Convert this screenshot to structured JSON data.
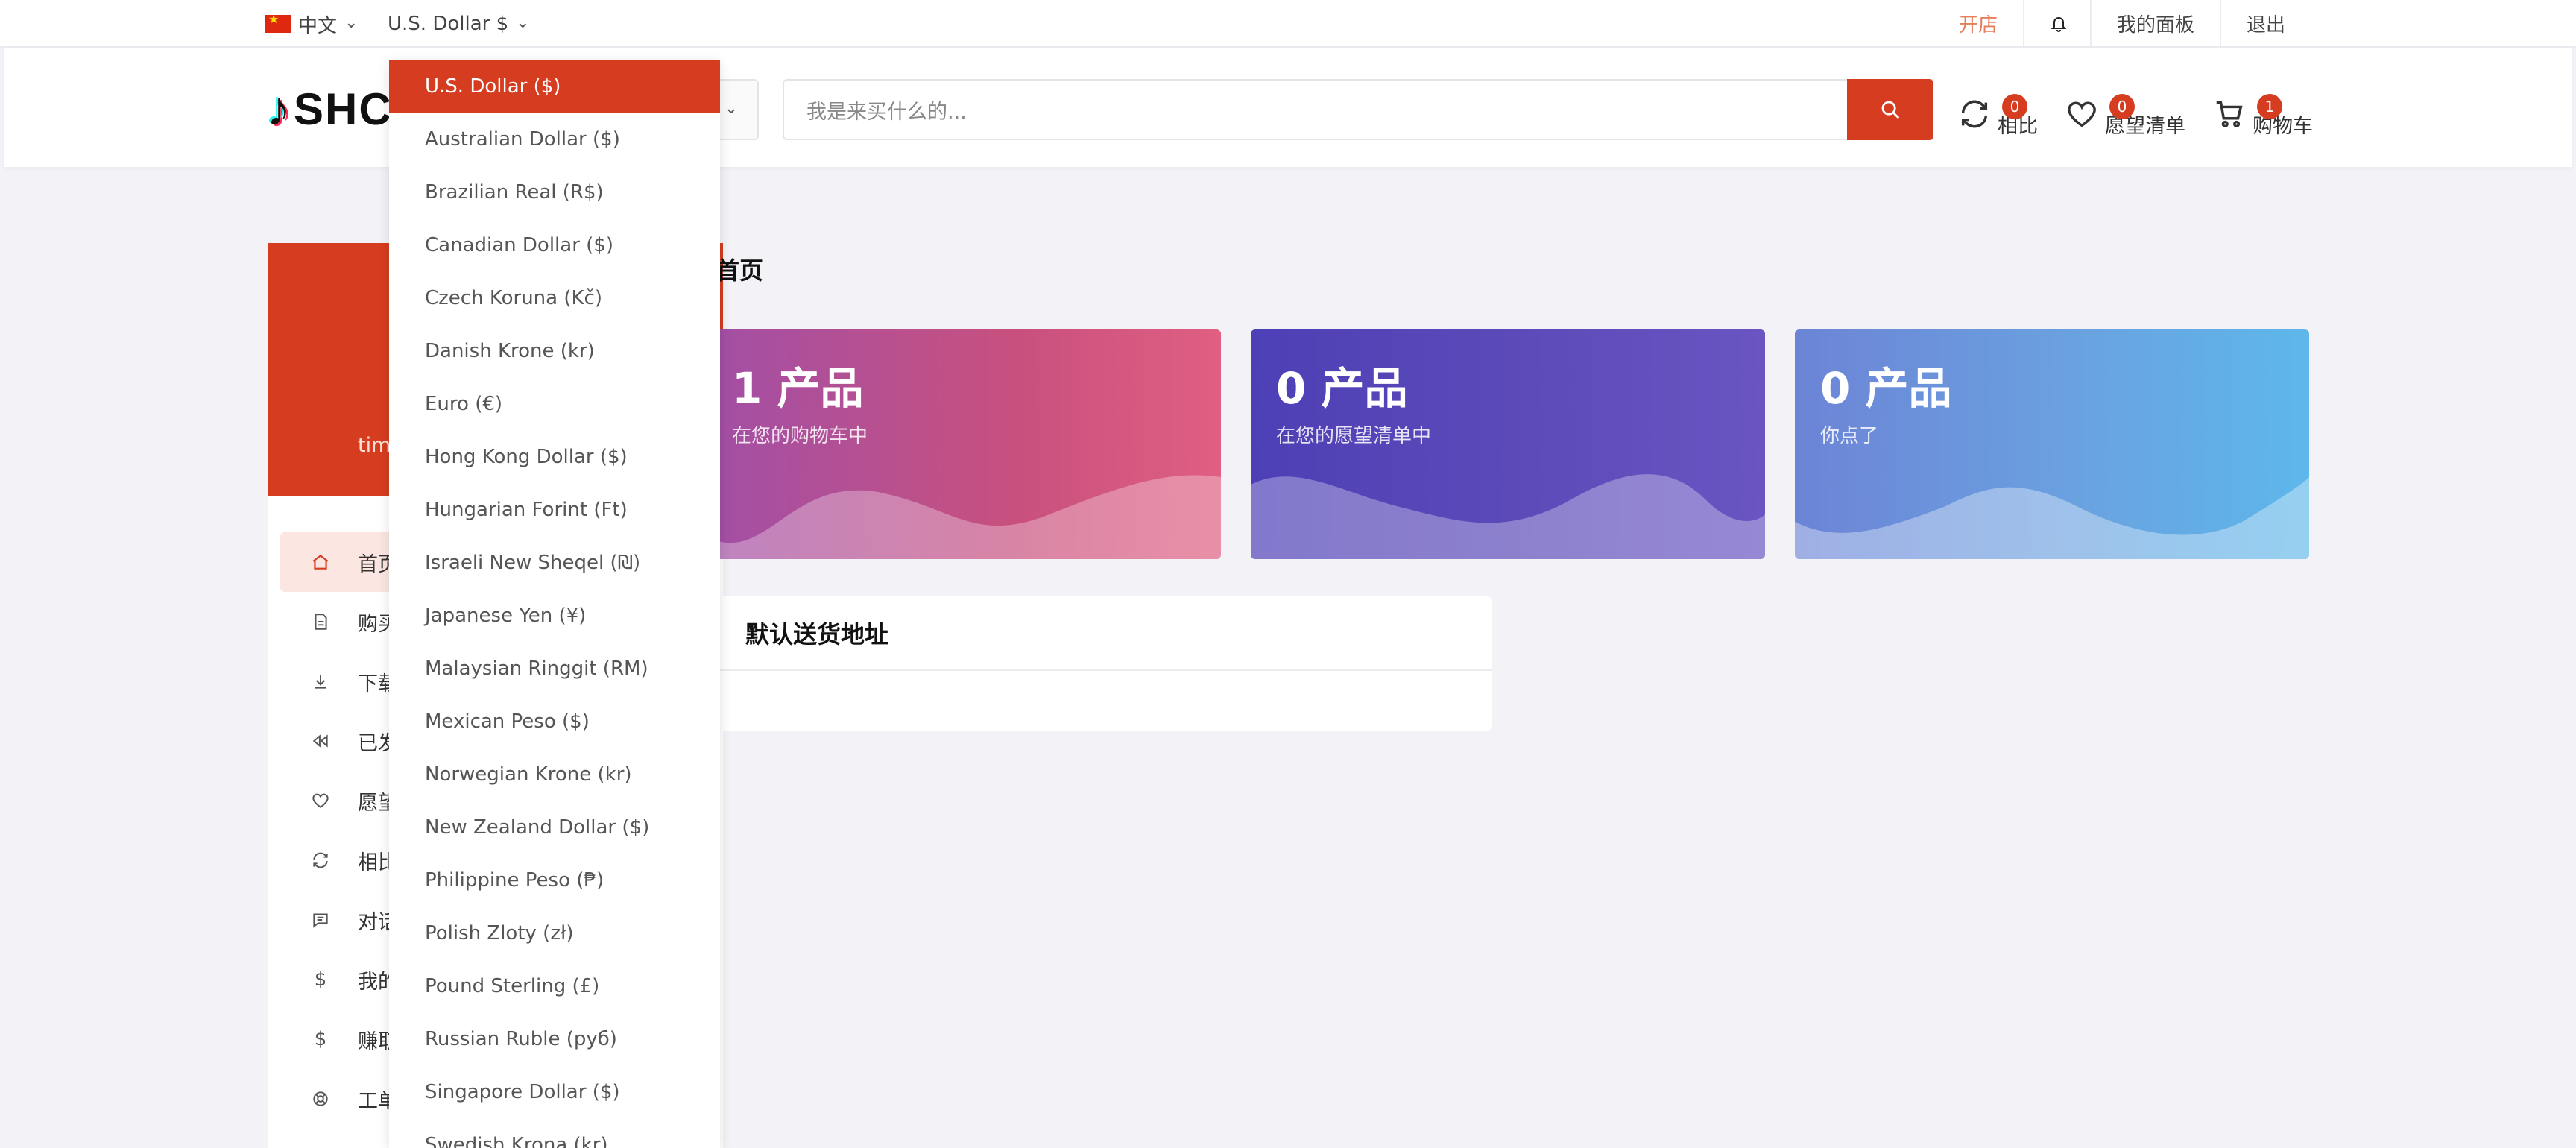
{
  "topbar": {
    "language": "中文",
    "currency": "U.S. Dollar $",
    "open_store": "开店",
    "dashboard": "我的面板",
    "logout": "退出"
  },
  "header": {
    "logo_text": "SHC",
    "search_placeholder": "我是来买什么的...",
    "compare": {
      "label": "相比",
      "count": "0"
    },
    "wishlist": {
      "label": "愿望清单",
      "count": "0"
    },
    "cart": {
      "label": "购物车",
      "count": "1"
    }
  },
  "sidebar": {
    "username_partial": "tim",
    "items": [
      {
        "label": "首页",
        "icon": "home-icon",
        "active": true
      },
      {
        "label": "购买",
        "icon": "document-icon"
      },
      {
        "label": "下载",
        "icon": "download-icon"
      },
      {
        "label": "已发",
        "icon": "rewind-icon"
      },
      {
        "label": "愿望",
        "icon": "heart-icon"
      },
      {
        "label": "相比",
        "icon": "refresh-icon"
      },
      {
        "label": "对话",
        "icon": "chat-icon"
      },
      {
        "label": "我的",
        "icon": "dollar-icon"
      },
      {
        "label": "赚取",
        "icon": "dollar-icon"
      },
      {
        "label": "工单",
        "icon": "support-icon"
      }
    ]
  },
  "main": {
    "page_title": "首页",
    "cards": [
      {
        "count": "1 产品",
        "desc": "在您的购物车中"
      },
      {
        "count": "0 产品",
        "desc": "在您的愿望清单中"
      },
      {
        "count": "0 产品",
        "desc": "你点了"
      }
    ],
    "address_title": "默认送货地址"
  },
  "currency_dropdown": {
    "selected": "U.S. Dollar ($)",
    "options": [
      "U.S. Dollar ($)",
      "Australian Dollar ($)",
      "Brazilian Real (R$)",
      "Canadian Dollar ($)",
      "Czech Koruna (Kč)",
      "Danish Krone (kr)",
      "Euro (€)",
      "Hong Kong Dollar ($)",
      "Hungarian Forint (Ft)",
      "Israeli New Sheqel (₪)",
      "Japanese Yen (¥)",
      "Malaysian Ringgit (RM)",
      "Mexican Peso ($)",
      "Norwegian Krone (kr)",
      "New Zealand Dollar ($)",
      "Philippine Peso (₱)",
      "Polish Zloty (zł)",
      "Pound Sterling (£)",
      "Russian Ruble (руб)",
      "Singapore Dollar ($)",
      "Swedish Krona (kr)"
    ]
  },
  "colors": {
    "accent": "#d63d20",
    "page_bg": "#f2f2f7"
  }
}
